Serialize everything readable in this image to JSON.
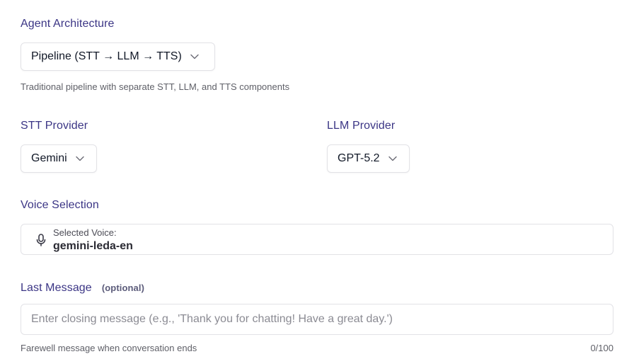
{
  "agent_architecture": {
    "label": "Agent Architecture",
    "selected": "Pipeline (STT → LLM → TTS)",
    "description": "Traditional pipeline with separate STT, LLM, and TTS components"
  },
  "stt_provider": {
    "label": "STT Provider",
    "selected": "Gemini"
  },
  "llm_provider": {
    "label": "LLM Provider",
    "selected": "GPT-5.2"
  },
  "voice_selection": {
    "label": "Voice Selection",
    "caption": "Selected Voice:",
    "value": "gemini-leda-en",
    "icon": "microphone-icon"
  },
  "last_message": {
    "label": "Last Message",
    "optional_tag": "(optional)",
    "placeholder": "Enter closing message (e.g., 'Thank you for chatting! Have a great day.')",
    "value": "",
    "helper": "Farewell message when conversation ends",
    "counter": "0/100"
  },
  "colors": {
    "label": "#3b3585",
    "border": "#e2e2e6",
    "muted_text": "#5f6068"
  }
}
